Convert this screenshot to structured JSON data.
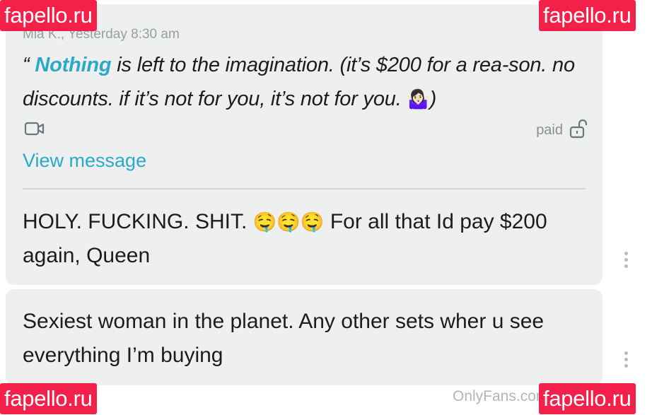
{
  "colors": {
    "bubble_bg": "#eef0f0",
    "accent": "#2aa9c9",
    "watermark_bg": "#f3204a",
    "muted_text": "#9a9ea1"
  },
  "watermark": {
    "text": "fapello.ru"
  },
  "message1": {
    "quote_header": "Mia K., Yesterday 8:30 am",
    "quote_open": "“ ",
    "quote_highlight": "Nothing",
    "quote_text": " is left to the imagination. (it’s $200 for a rea-son. no discounts. if it’s not for you, it’s not for you. ",
    "quote_emoji": "🤷🏻‍♀️",
    "quote_close": ")",
    "attachment_icon": "video-icon",
    "paid_label": "paid",
    "lock_icon": "unlock-icon",
    "view_message": "View message",
    "reply_text_before": "HOLY. FUCKING. SHIT. ",
    "reply_emoji": "🤤🤤🤤",
    "reply_text_after": " For all that Id pay $200 again, Queen",
    "menu_icon": "more-vertical-icon"
  },
  "message2": {
    "text": "Sexiest woman in the planet. Any other sets wher u see everything I’m buying",
    "menu_icon": "more-vertical-icon"
  },
  "footer": {
    "text": "OnlyFans.com"
  }
}
